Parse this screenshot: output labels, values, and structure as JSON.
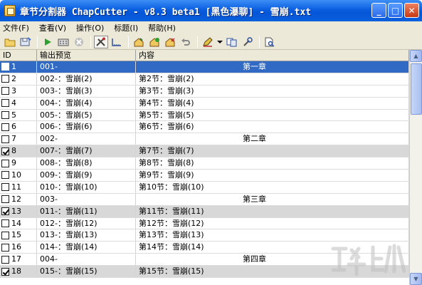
{
  "window": {
    "title": "章节分割器 ChapCutter - v8.3 beta1 [黑色瀑聊] - 雪崩.txt",
    "buttons": {
      "minimize": "_",
      "maximize": "□",
      "close": "✕"
    }
  },
  "menu": [
    {
      "label": "文件(F)"
    },
    {
      "label": "查看(V)"
    },
    {
      "label": "操作(O)"
    },
    {
      "label": "标题(I)"
    },
    {
      "label": "帮助(H)"
    }
  ],
  "grid": {
    "headers": {
      "id": "ID",
      "preview": "输出预览",
      "content": "内容"
    },
    "rows": [
      {
        "id": "1",
        "checked": false,
        "selected": true,
        "shaded": false,
        "preview": "001-",
        "content": "第一章",
        "chapter": true
      },
      {
        "id": "2",
        "checked": false,
        "selected": false,
        "shaded": false,
        "preview": "002-：雪崩(2)",
        "content": "第2节：雪崩(2)",
        "chapter": false
      },
      {
        "id": "3",
        "checked": false,
        "selected": false,
        "shaded": false,
        "preview": "003-：雪崩(3)",
        "content": "第3节：雪崩(3)",
        "chapter": false
      },
      {
        "id": "4",
        "checked": false,
        "selected": false,
        "shaded": false,
        "preview": "004-：雪崩(4)",
        "content": "第4节：雪崩(4)",
        "chapter": false
      },
      {
        "id": "5",
        "checked": false,
        "selected": false,
        "shaded": false,
        "preview": "005-：雪崩(5)",
        "content": "第5节：雪崩(5)",
        "chapter": false
      },
      {
        "id": "6",
        "checked": false,
        "selected": false,
        "shaded": false,
        "preview": "006-：雪崩(6)",
        "content": "第6节：雪崩(6)",
        "chapter": false
      },
      {
        "id": "7",
        "checked": false,
        "selected": false,
        "shaded": false,
        "preview": "002-",
        "content": "第二章",
        "chapter": true
      },
      {
        "id": "8",
        "checked": true,
        "selected": false,
        "shaded": true,
        "preview": "007-：雪崩(7)",
        "content": "第7节：雪崩(7)",
        "chapter": false
      },
      {
        "id": "9",
        "checked": false,
        "selected": false,
        "shaded": false,
        "preview": "008-：雪崩(8)",
        "content": "第8节：雪崩(8)",
        "chapter": false
      },
      {
        "id": "10",
        "checked": false,
        "selected": false,
        "shaded": false,
        "preview": "009-：雪崩(9)",
        "content": "第9节：雪崩(9)",
        "chapter": false
      },
      {
        "id": "11",
        "checked": false,
        "selected": false,
        "shaded": false,
        "preview": "010-：雪崩(10)",
        "content": "第10节：雪崩(10)",
        "chapter": false
      },
      {
        "id": "12",
        "checked": false,
        "selected": false,
        "shaded": false,
        "preview": "003-",
        "content": "第三章",
        "chapter": true
      },
      {
        "id": "13",
        "checked": true,
        "selected": false,
        "shaded": true,
        "preview": "011-：雪崩(11)",
        "content": "第11节：雪崩(11)",
        "chapter": false
      },
      {
        "id": "14",
        "checked": false,
        "selected": false,
        "shaded": false,
        "preview": "012-：雪崩(12)",
        "content": "第12节：雪崩(12)",
        "chapter": false
      },
      {
        "id": "15",
        "checked": false,
        "selected": false,
        "shaded": false,
        "preview": "013-：雪崩(13)",
        "content": "第13节：雪崩(13)",
        "chapter": false
      },
      {
        "id": "16",
        "checked": false,
        "selected": false,
        "shaded": false,
        "preview": "014-：雪崩(14)",
        "content": "第14节：雪崩(14)",
        "chapter": false
      },
      {
        "id": "17",
        "checked": false,
        "selected": false,
        "shaded": false,
        "preview": "004-",
        "content": "第四章",
        "chapter": true
      },
      {
        "id": "18",
        "checked": true,
        "selected": false,
        "shaded": true,
        "preview": "015-：雪崩(15)",
        "content": "第15节：雪崩(15)",
        "chapter": false
      }
    ]
  },
  "colors": {
    "titlebar": "#0a5fe0",
    "selection": "#316ac5",
    "shaded_row": "#d8d8d8",
    "chrome": "#ece9d8"
  },
  "icons": [
    "open-folder-icon",
    "save-icon",
    "run-icon",
    "calculator-icon",
    "stop-icon",
    "tools-icon",
    "ruler-icon",
    "house-icon",
    "house-add-icon",
    "house-remove-icon",
    "undo-icon",
    "pen-icon",
    "copy-icon",
    "settings-icon",
    "document-search-icon"
  ]
}
